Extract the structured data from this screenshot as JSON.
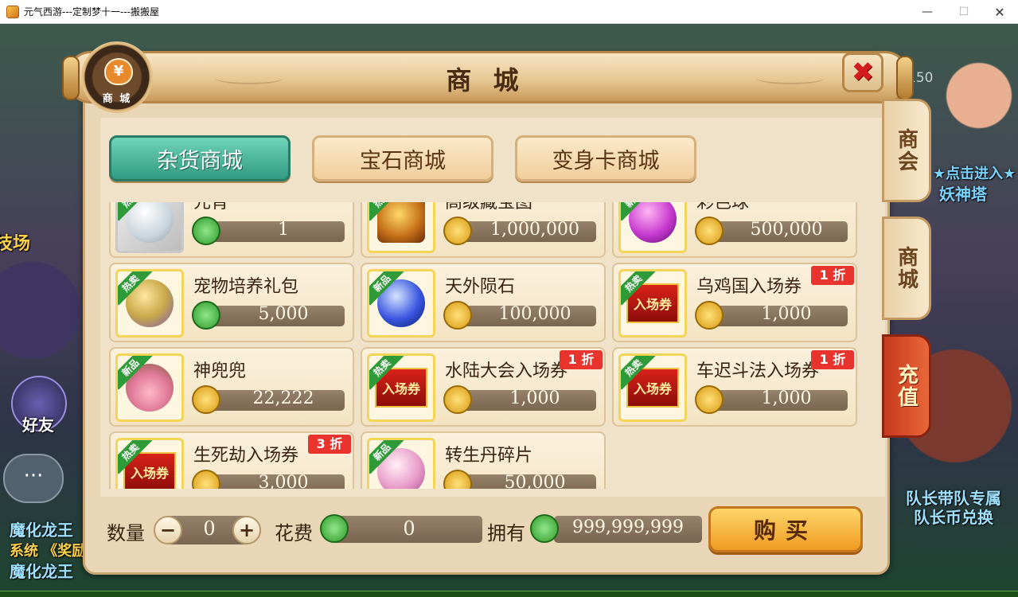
{
  "window": {
    "title": "元气西游---定制梦十一---搬搬屋",
    "minimize": "—",
    "maximize": "☐",
    "close": "✕"
  },
  "background": {
    "left_texts": [
      "技场",
      "好友",
      "魔化龙王",
      "系统 《奖励",
      "魔化龙王"
    ],
    "right_texts": [
      "队长带队专属",
      "队长币兑换",
      "★点击进入★",
      "妖神塔"
    ],
    "level": "150",
    "chat_icon": "···"
  },
  "panel": {
    "title": "商 城",
    "emblem_label": "商 城",
    "emblem_icon": "money-bag-icon",
    "emblem_symbol": "¥",
    "close_label": "✖"
  },
  "side_tabs": [
    {
      "label": "商会"
    },
    {
      "label": "商城"
    },
    {
      "label": "充值"
    }
  ],
  "shop_tabs": [
    {
      "label": "杂货商城",
      "active": true
    },
    {
      "label": "宝石商城",
      "active": false
    },
    {
      "label": "变身卡商城",
      "active": false
    }
  ],
  "items": [
    {
      "name": "元宵",
      "price": "1",
      "currency": "jade",
      "tag": "热卖",
      "discount": ""
    },
    {
      "name": "高级藏宝图",
      "price": "1,000,000",
      "currency": "gold",
      "tag": "热卖",
      "discount": ""
    },
    {
      "name": "彩色球",
      "price": "500,000",
      "currency": "gold",
      "tag": "新品",
      "discount": ""
    },
    {
      "name": "宠物培养礼包",
      "price": "5,000",
      "currency": "jade",
      "tag": "热卖",
      "discount": ""
    },
    {
      "name": "天外陨石",
      "price": "100,000",
      "currency": "gold",
      "tag": "新品",
      "discount": ""
    },
    {
      "name": "乌鸡国入场券",
      "price": "1,000",
      "currency": "gold",
      "tag": "热卖",
      "discount": "1 折"
    },
    {
      "name": "神兜兜",
      "price": "22,222",
      "currency": "gold",
      "tag": "新品",
      "discount": ""
    },
    {
      "name": "水陆大会入场券",
      "price": "1,000",
      "currency": "gold",
      "tag": "热卖",
      "discount": "1 折"
    },
    {
      "name": "车迟斗法入场券",
      "price": "1,000",
      "currency": "gold",
      "tag": "热卖",
      "discount": "1 折"
    },
    {
      "name": "生死劫入场券",
      "price": "3,000",
      "currency": "gold",
      "tag": "热卖",
      "discount": "3 折"
    },
    {
      "name": "转生丹碎片",
      "price": "50,000",
      "currency": "gold",
      "tag": "新品",
      "discount": ""
    }
  ],
  "ticket_text": "入场券",
  "bottom": {
    "qty_label": "数量",
    "qty_value": "0",
    "minus": "−",
    "plus": "+",
    "cost_label": "花费",
    "cost_value": "0",
    "own_label": "拥有",
    "own_value": "999,999,999",
    "buy_label": "购买"
  },
  "colors": {
    "accent_active_tab": "#319a80",
    "discount_red": "#e8342c",
    "buy_orange": "#f09b22"
  }
}
